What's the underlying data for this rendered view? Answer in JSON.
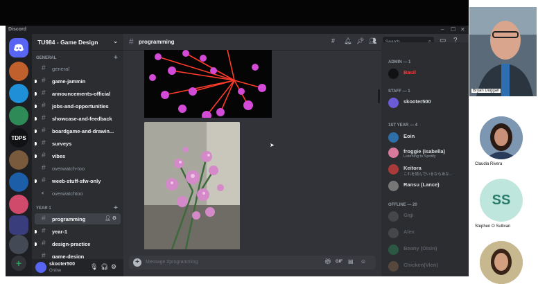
{
  "window": {
    "app_name": "Discord",
    "controls": [
      "–",
      "☐",
      "✕"
    ]
  },
  "server_rail": {
    "items": [
      {
        "icon": "discord-logo-icon",
        "color": "#5865f2",
        "text": ""
      },
      {
        "icon": "server-avatar-icon",
        "color": "#c0602d",
        "text": ""
      },
      {
        "icon": "server-avatar-icon",
        "color": "#1f8fd8",
        "text": ""
      },
      {
        "icon": "server-avatar-icon",
        "color": "#2e8b57",
        "text": ""
      },
      {
        "icon": "server-text-icon",
        "color": "#111214",
        "text": "TDPS"
      },
      {
        "icon": "server-avatar-icon",
        "color": "#7a5a3c",
        "text": ""
      },
      {
        "icon": "server-avatar-icon",
        "color": "#1c5fa8",
        "text": ""
      },
      {
        "icon": "server-avatar-icon",
        "color": "#d04a6c",
        "text": ""
      },
      {
        "icon": "server-folder-icon",
        "color": "#3a3d7c",
        "text": ""
      },
      {
        "icon": "server-avatar-icon",
        "color": "#444a55",
        "text": ""
      },
      {
        "icon": "add-server-icon",
        "color": "#313338",
        "text": "+"
      },
      {
        "icon": "explore-icon",
        "color": "#313338",
        "text": ""
      }
    ]
  },
  "guild": {
    "name": "TU984 - Game Design"
  },
  "categories": [
    {
      "label": "GENERAL",
      "channels": [
        {
          "name": "general",
          "bright": false
        },
        {
          "name": "game-jammin",
          "bright": true
        },
        {
          "name": "announcements-official",
          "bright": true
        },
        {
          "name": "jobs-and-opportunities",
          "bright": true
        },
        {
          "name": "showcase-and-feedback",
          "bright": true
        },
        {
          "name": "boardgame-and-drawin...",
          "bright": true
        },
        {
          "name": "surveys",
          "bright": true
        },
        {
          "name": "vibes",
          "bright": true
        },
        {
          "name": "overwatch-too",
          "bright": false
        },
        {
          "name": "weeb-stuff-sfw-only",
          "bright": true
        },
        {
          "name": "overwatchtoo",
          "bright": false
        }
      ]
    },
    {
      "label": "YEAR 1",
      "channels": [
        {
          "name": "programming",
          "bright": true
        },
        {
          "name": "year-1",
          "bright": true
        },
        {
          "name": "design-practice",
          "bright": true
        },
        {
          "name": "game-design",
          "bright": true
        }
      ]
    }
  ],
  "user_panel": {
    "name": "skooter500",
    "status": "Online"
  },
  "header": {
    "channel": "programming",
    "search_placeholder": "Search"
  },
  "composer": {
    "placeholder": "Message #programming"
  },
  "members": {
    "groups": [
      {
        "label": "ADMIN — 1",
        "members": [
          {
            "name": "Basil",
            "status": "",
            "color": "#f23f42",
            "avatar": "#111214"
          }
        ]
      },
      {
        "label": "STAFF — 1",
        "members": [
          {
            "name": "skooter500",
            "status": "",
            "color": "#dbdee1",
            "avatar": "#6b5bd6"
          }
        ]
      },
      {
        "label": "1ST YEAR — 4",
        "members": [
          {
            "name": "Eoin",
            "status": "",
            "color": "#dbdee1",
            "avatar": "#2e6fa8"
          },
          {
            "name": "froggie (isabella)",
            "status": "Listening to Spotify",
            "color": "#dbdee1",
            "avatar": "#d87a9c"
          },
          {
            "name": "Keitora",
            "status": "これを読んでいるならあな...",
            "color": "#dbdee1",
            "avatar": "#a83a3a"
          },
          {
            "name": "Ransu (Lance)",
            "status": "",
            "color": "#dbdee1",
            "avatar": "#777"
          }
        ]
      },
      {
        "label": "OFFLINE — 20",
        "members": [
          {
            "name": "Gigi",
            "status": "",
            "color": "#949ba4",
            "avatar": "#666"
          },
          {
            "name": "Alex",
            "status": "",
            "color": "#949ba4",
            "avatar": "#666"
          },
          {
            "name": "Beany (Oisin)",
            "status": "",
            "color": "#949ba4",
            "avatar": "#2e8b57"
          },
          {
            "name": "Chicken(Vien)",
            "status": "",
            "color": "#949ba4",
            "avatar": "#8a6a4a"
          }
        ]
      }
    ]
  },
  "video_call": {
    "participants": [
      {
        "name": "Bryan Duggan"
      },
      {
        "name": "Claudia Rivera"
      },
      {
        "name": "Stephen O Sullivan",
        "initials": "SS"
      },
      {
        "name": ""
      }
    ]
  }
}
